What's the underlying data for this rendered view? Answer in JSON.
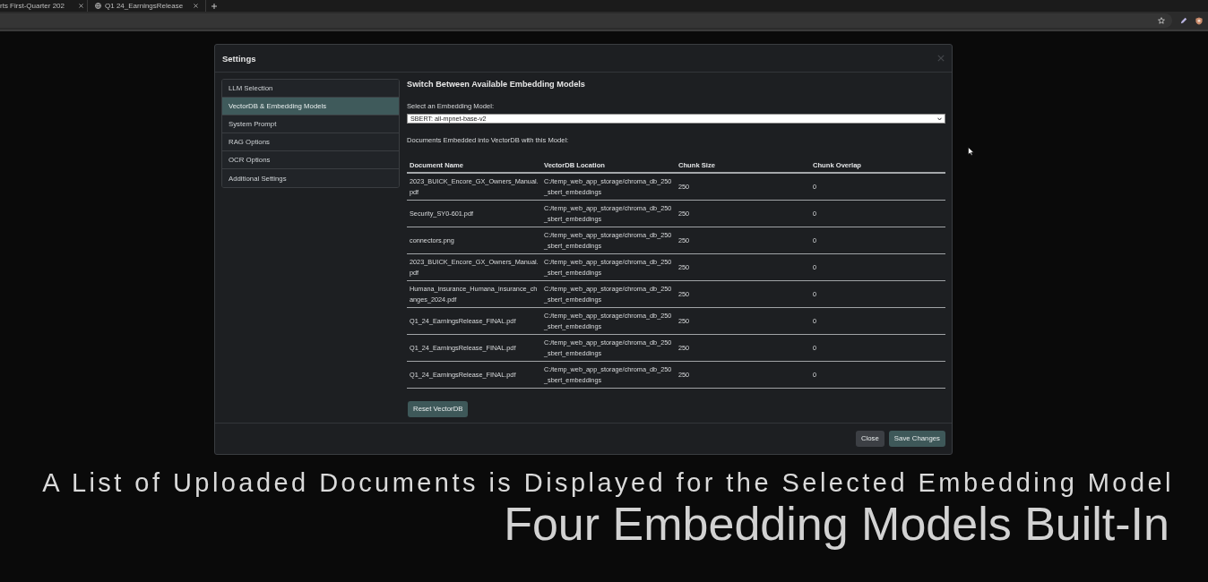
{
  "browser": {
    "tabs": [
      {
        "title": "rts First-Quarter 202"
      },
      {
        "title": "Q1 24_EarningsRelease"
      }
    ]
  },
  "modal": {
    "title": "Settings"
  },
  "sidebar": {
    "items": [
      {
        "label": "LLM Selection",
        "selected": false
      },
      {
        "label": "VectorDB & Embedding Models",
        "selected": true
      },
      {
        "label": "System Prompt",
        "selected": false
      },
      {
        "label": "RAG Options",
        "selected": false
      },
      {
        "label": "OCR Options",
        "selected": false
      },
      {
        "label": "Additional Settings",
        "selected": false
      }
    ]
  },
  "content": {
    "heading": "Switch Between Available Embedding Models",
    "select_label": "Select an Embedding Model:",
    "select_value": "SBERT: all-mpnet-base-v2",
    "documents_label": "Documents Embedded into VectorDB with this Model:",
    "table": {
      "columns": [
        "Document Name",
        "VectorDB Location",
        "Chunk Size",
        "Chunk Overlap"
      ],
      "rows": [
        [
          "2023_BUICK_Encore_GX_Owners_Manual.pdf",
          "C:/temp_web_app_storage/chroma_db_250_sbert_embeddings",
          "250",
          "0"
        ],
        [
          "Security_SY0-601.pdf",
          "C:/temp_web_app_storage/chroma_db_250_sbert_embeddings",
          "250",
          "0"
        ],
        [
          "connectors.png",
          "C:/temp_web_app_storage/chroma_db_250_sbert_embeddings",
          "250",
          "0"
        ],
        [
          "2023_BUICK_Encore_GX_Owners_Manual.pdf",
          "C:/temp_web_app_storage/chroma_db_250_sbert_embeddings",
          "250",
          "0"
        ],
        [
          "Humana_insurance_Humana_insurance_changes_2024.pdf",
          "C:/temp_web_app_storage/chroma_db_250_sbert_embeddings",
          "250",
          "0"
        ],
        [
          "Q1_24_EarningsRelease_FINAL.pdf",
          "C:/temp_web_app_storage/chroma_db_250_sbert_embeddings",
          "250",
          "0"
        ],
        [
          "Q1_24_EarningsRelease_FINAL.pdf",
          "C:/temp_web_app_storage/chroma_db_250_sbert_embeddings",
          "250",
          "0"
        ],
        [
          "Q1_24_EarningsRelease_FINAL.pdf",
          "C:/temp_web_app_storage/chroma_db_250_sbert_embeddings",
          "250",
          "0"
        ]
      ]
    },
    "reset_button": "Reset VectorDB"
  },
  "footer": {
    "buttons": [
      {
        "label": "Close",
        "kind": "secondary"
      },
      {
        "label": "Save Changes",
        "kind": "primary"
      }
    ]
  },
  "caption": {
    "subtitle": "A List of Uploaded Documents is Displayed for the Selected Embedding Model",
    "title": "Four Embedding Models Built-In"
  }
}
